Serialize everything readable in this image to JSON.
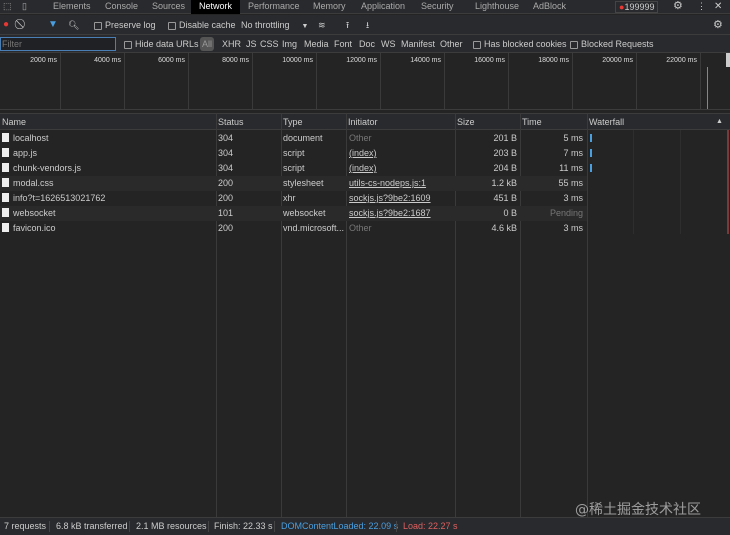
{
  "tabs": [
    "Elements",
    "Console",
    "Sources",
    "Network",
    "Performance",
    "Memory",
    "Application",
    "Security",
    "Lighthouse",
    "AdBlock"
  ],
  "active_tab": "Network",
  "error_count": "199999",
  "toolbar": {
    "preserve_log": "Preserve log",
    "disable_cache": "Disable cache",
    "throttling": "No throttling"
  },
  "filter": {
    "placeholder": "Filter",
    "hide_data_urls": "Hide data URLs",
    "types": [
      "All",
      "XHR",
      "JS",
      "CSS",
      "Img",
      "Media",
      "Font",
      "Doc",
      "WS",
      "Manifest",
      "Other"
    ],
    "has_blocked_cookies": "Has blocked cookies",
    "blocked_requests": "Blocked Requests"
  },
  "overview": {
    "ticks": [
      "2000 ms",
      "4000 ms",
      "6000 ms",
      "8000 ms",
      "10000 ms",
      "12000 ms",
      "14000 ms",
      "16000 ms",
      "18000 ms",
      "20000 ms",
      "22000 ms"
    ]
  },
  "columns": {
    "name": "Name",
    "status": "Status",
    "type": "Type",
    "initiator": "Initiator",
    "size": "Size",
    "time": "Time",
    "waterfall": "Waterfall"
  },
  "rows": [
    {
      "name": "localhost",
      "status": "304",
      "type": "document",
      "initiator": "Other",
      "size": "201 B",
      "time": "5 ms"
    },
    {
      "name": "app.js",
      "status": "304",
      "type": "script",
      "initiator": "(index)",
      "size": "203 B",
      "time": "7 ms"
    },
    {
      "name": "chunk-vendors.js",
      "status": "304",
      "type": "script",
      "initiator": "(index)",
      "size": "204 B",
      "time": "11 ms"
    },
    {
      "name": "modal.css",
      "status": "200",
      "type": "stylesheet",
      "initiator": "utils-cs-nodeps.js:1",
      "size": "1.2 kB",
      "time": "55 ms"
    },
    {
      "name": "info?t=1626513021762",
      "status": "200",
      "type": "xhr",
      "initiator": "sockjs.js?9be2:1609",
      "size": "451 B",
      "time": "3 ms"
    },
    {
      "name": "websocket",
      "status": "101",
      "type": "websocket",
      "initiator": "sockjs.js?9be2:1687",
      "size": "0 B",
      "time": "Pending"
    },
    {
      "name": "favicon.ico",
      "status": "200",
      "type": "vnd.microsoft...",
      "initiator": "Other",
      "size": "4.6 kB",
      "time": "3 ms"
    }
  ],
  "footer": {
    "requests": "7 requests",
    "transferred": "6.8 kB transferred",
    "resources": "2.1 MB resources",
    "finish": "Finish: 22.33 s",
    "dcl": "DOMContentLoaded: 22.09 s",
    "load": "Load: 22.27 s"
  },
  "watermark": "@稀土掘金技术社区",
  "colors": {
    "dcl": "#4a9fe0",
    "load": "#e06060",
    "record": "#e53935"
  }
}
